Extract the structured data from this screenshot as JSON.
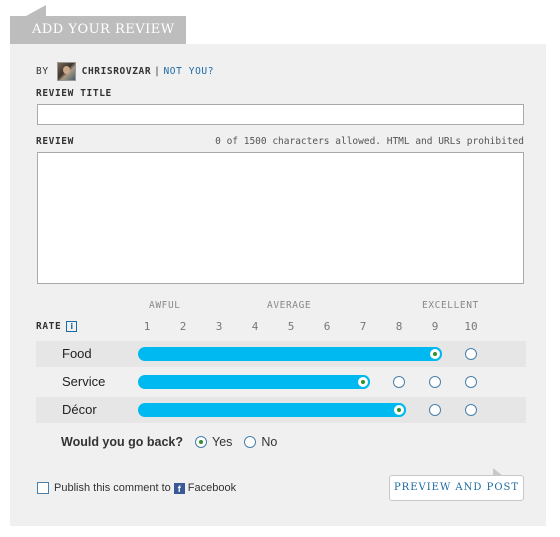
{
  "header": {
    "tab_title": "ADD YOUR REVIEW"
  },
  "author": {
    "by_label": "BY",
    "username": "CHRISROVZAR",
    "separator": "|",
    "not_you_link": "NOT YOU?"
  },
  "form": {
    "title_label": "REVIEW TITLE",
    "title_value": "",
    "review_label": "REVIEW",
    "review_value": "",
    "char_notice": "0 of 1500 characters allowed. HTML and URLs prohibited"
  },
  "rating": {
    "label": "RATE",
    "info_icon": "info-icon",
    "info_glyph": "i",
    "scale_low": "AWFUL",
    "scale_mid": "AVERAGE",
    "scale_high": "EXCELLENT",
    "scale_numbers": [
      "1",
      "2",
      "3",
      "4",
      "5",
      "6",
      "7",
      "8",
      "9",
      "10"
    ],
    "accent_color": "#00b9f1",
    "categories": [
      {
        "name": "Food",
        "value": 9
      },
      {
        "name": "Service",
        "value": 7
      },
      {
        "name": "Décor",
        "value": 8
      }
    ]
  },
  "go_back": {
    "question": "Would you go back?",
    "options": [
      "Yes",
      "No"
    ],
    "selected": "Yes"
  },
  "share": {
    "publish_text": "Publish this comment to",
    "facebook_label": "Facebook",
    "facebook_icon": "facebook-icon",
    "facebook_glyph": "f"
  },
  "submit": {
    "label": "PREVIEW AND POST"
  }
}
